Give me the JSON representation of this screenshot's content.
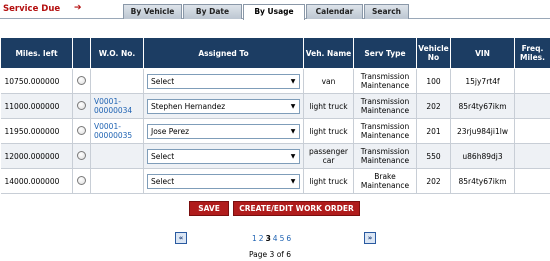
{
  "header": {
    "title": "Service Due",
    "arrow": "➔",
    "tabs": [
      {
        "label": "By Vehicle",
        "active": false
      },
      {
        "label": "By Date",
        "active": false
      },
      {
        "label": "By Usage",
        "active": true
      },
      {
        "label": "Calendar",
        "active": false
      },
      {
        "label": "Search",
        "active": false
      }
    ]
  },
  "table": {
    "columns": [
      "Miles. left",
      "",
      "W.O. No.",
      "Assigned To",
      "Veh. Name",
      "Serv Type",
      "Vehicle No",
      "VIN",
      "Freq. Miles."
    ],
    "rows": [
      {
        "miles": "10750.000000",
        "wo_line1": "",
        "wo_line2": "",
        "assigned": "Select",
        "veh_name": "van",
        "serv_line1": "Transmission",
        "serv_line2": "Maintenance",
        "vehicle_no": "100",
        "vin": "15jy7rt4f",
        "freq": ""
      },
      {
        "miles": "11000.000000",
        "wo_line1": "V0001-",
        "wo_line2": "00000034",
        "assigned": "Stephen Hernandez",
        "veh_name": "light truck",
        "serv_line1": "Transmission",
        "serv_line2": "Maintenance",
        "vehicle_no": "202",
        "vin": "85r4ty67ikm",
        "freq": ""
      },
      {
        "miles": "11950.000000",
        "wo_line1": "V0001-",
        "wo_line2": "00000035",
        "assigned": "Jose Perez",
        "veh_name": "light truck",
        "serv_line1": "Transmission",
        "serv_line2": "Maintenance",
        "vehicle_no": "201",
        "vin": "23rju984ji1lw",
        "freq": ""
      },
      {
        "miles": "12000.000000",
        "wo_line1": "",
        "wo_line2": "",
        "assigned": "Select",
        "veh_name": "passenger car",
        "serv_line1": "Transmission",
        "serv_line2": "Maintenance",
        "vehicle_no": "550",
        "vin": "u86h89dj3",
        "freq": ""
      },
      {
        "miles": "14000.000000",
        "wo_line1": "",
        "wo_line2": "",
        "assigned": "Select",
        "veh_name": "light truck",
        "serv_line1": "Brake",
        "serv_line2": "Maintenance",
        "vehicle_no": "202",
        "vin": "85r4ty67ikm",
        "freq": ""
      }
    ]
  },
  "buttons": {
    "save": "SAVE",
    "create_edit": "CREATE/EDIT WORK ORDER"
  },
  "pagination": {
    "prev_icon": "«",
    "next_icon": "»",
    "pages": [
      "1",
      "2",
      "3",
      "4",
      "5",
      "6"
    ],
    "current_page": "3",
    "page_info": "Page 3 of 6"
  },
  "colors": {
    "title": "#b40f0f",
    "header_bg": "#1c3d63",
    "button_bg": "#b01c1c",
    "link": "#1f63b3"
  }
}
